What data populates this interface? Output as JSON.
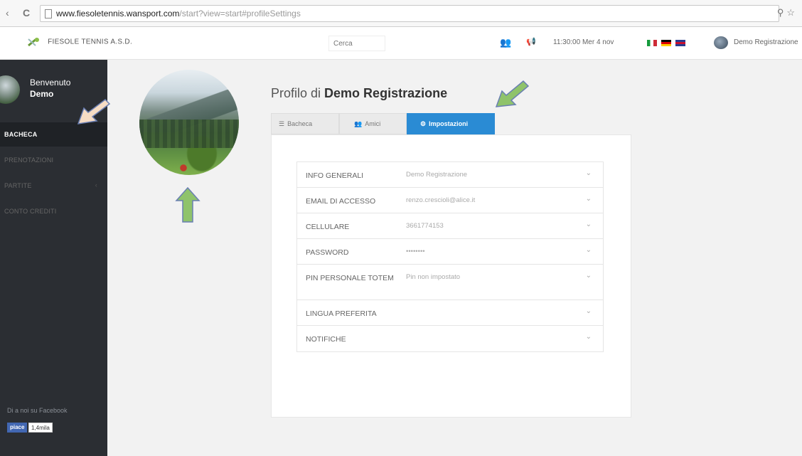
{
  "browser": {
    "url_host": "www.fiesoletennis.wansport.com",
    "url_path": "/start?view=start#profileSettings",
    "reload_icon": "reload-icon",
    "right_icons": "key-icon star-icon"
  },
  "header": {
    "brand": "FIESOLE TENNIS A.S.D.",
    "search_placeholder": "Cerca",
    "clock": "11:30:00  Mer 4 nov",
    "user_name": "Demo Registrazione"
  },
  "sidebar": {
    "welcome": "Benvenuto",
    "user_first": "Demo",
    "items": [
      {
        "label": "BACHECA",
        "active": true
      },
      {
        "label": "PRENOTAZIONI"
      },
      {
        "label": "PARTITE"
      },
      {
        "label": "CONTO CREDITI"
      }
    ],
    "facebook_text": "Di a noi su Facebook",
    "like_label": "piace",
    "like_count": "1,4mila"
  },
  "main": {
    "title_prefix": "Profilo di",
    "title_name": "Demo Registrazione",
    "tabs": [
      {
        "label": "Bacheca"
      },
      {
        "label": "Amici"
      },
      {
        "label": "Impostazioni",
        "active": true
      }
    ],
    "settings": [
      {
        "label": "INFO GENERALI",
        "value": "Demo Registrazione"
      },
      {
        "label": "EMAIL DI ACCESSO",
        "value": "renzo.crescioli@alice.it"
      },
      {
        "label": "CELLULARE",
        "value": "3661774153"
      },
      {
        "label": "PASSWORD",
        "value": "••••••••"
      },
      {
        "label": "PIN PERSONALE TOTEM",
        "value": "Pin non impostato"
      },
      {
        "label": "LINGUA PREFERITA",
        "value": ""
      },
      {
        "label": "NOTIFICHE",
        "value": ""
      }
    ]
  },
  "colors": {
    "accent": "#2a8bd4",
    "sidebar_bg": "#2b2e33",
    "arrow_green": "#8fc36b",
    "arrow_peach": "#f6dcc4"
  }
}
